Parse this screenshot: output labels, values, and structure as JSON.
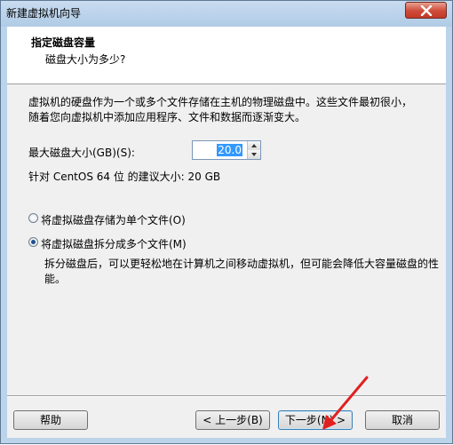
{
  "window": {
    "title": "新建虚拟机向导"
  },
  "header": {
    "title": "指定磁盘容量",
    "subtitle": "磁盘大小为多少?"
  },
  "description": "虚拟机的硬盘作为一个或多个文件存储在主机的物理磁盘中。这些文件最初很小，随着您向虚拟机中添加应用程序、文件和数据而逐渐变大。",
  "disk_size": {
    "label": "最大磁盘大小(GB)(S):",
    "value": "20.0"
  },
  "recommendation": "针对 CentOS 64 位 的建议大小: 20 GB",
  "options": [
    {
      "label": "将虚拟磁盘存储为单个文件(O)",
      "selected": false
    },
    {
      "label": "将虚拟磁盘拆分成多个文件(M)",
      "selected": true
    }
  ],
  "note": "拆分磁盘后，可以更轻松地在计算机之间移动虚拟机，但可能会降低大容量磁盘的性能。",
  "buttons": {
    "help": "帮助",
    "back": "< 上一步(B)",
    "next": "下一步(N) >",
    "cancel": "取消"
  },
  "colors": {
    "selection": "#3399ff",
    "annotation_arrow": "#e02020"
  },
  "icons": {
    "close": "close-icon",
    "spin_up": "chevron-up-icon",
    "spin_down": "chevron-down-icon"
  }
}
